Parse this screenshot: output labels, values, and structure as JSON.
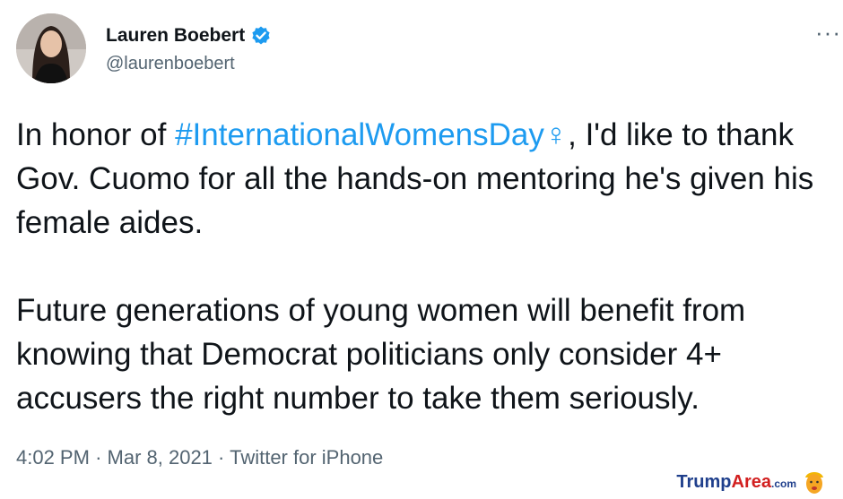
{
  "tweet": {
    "author_name": "Lauren Boebert",
    "author_handle": "@laurenboebert",
    "more_label": "···",
    "paragraph1": {
      "before_hashtag": "In honor of ",
      "hashtag": "#InternationalWomensDay",
      "female_sign": "♀",
      "after_hashtag": ", I'd like to thank Gov. Cuomo for all the hands-on mentoring he's given his female aides."
    },
    "paragraph2": "Future generations of young women will benefit from knowing that Democrat politicians only consider 4+ accusers the right number to take them seriously.",
    "time": "4:02 PM",
    "separator": "·",
    "date": "Mar 8, 2021",
    "source": "Twitter for iPhone"
  },
  "watermark": {
    "part1": "Trump",
    "part2": "Area",
    "suffix": ".com"
  },
  "colors": {
    "link": "#1d9bf0",
    "secondary_text": "#536471",
    "primary_text": "#0f1419"
  },
  "icons": [
    "verified-badge-icon",
    "more-options-icon",
    "female-sign-icon",
    "watermark-face-icon"
  ]
}
